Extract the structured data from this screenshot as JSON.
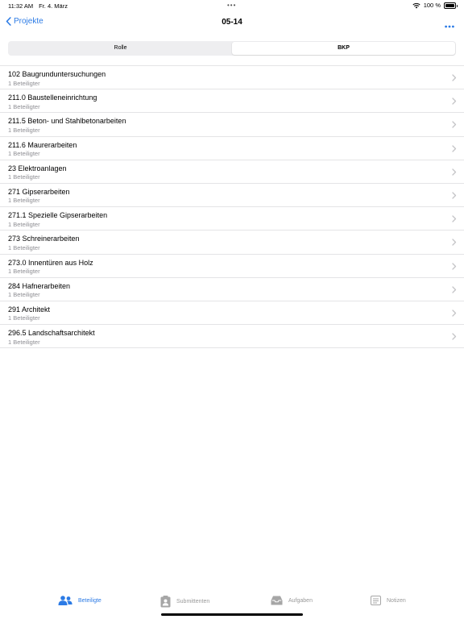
{
  "status_bar": {
    "time": "11:32 AM",
    "date": "Fr. 4. März",
    "dots": "•••",
    "battery": "100 %"
  },
  "nav": {
    "back_label": "Projekte",
    "title": "05-14"
  },
  "segments": [
    {
      "label": "Rolle",
      "selected": false
    },
    {
      "label": "BKP",
      "selected": true
    }
  ],
  "list": [
    {
      "title": "102 Baugrunduntersuchungen",
      "subtitle": "1 Beteiligter"
    },
    {
      "title": "211.0 Baustelleneinrichtung",
      "subtitle": "1 Beteiligter"
    },
    {
      "title": "211.5 Beton- und Stahlbetonarbeiten",
      "subtitle": "1 Beteiligter"
    },
    {
      "title": "211.6 Maurerarbeiten",
      "subtitle": "1 Beteiligter"
    },
    {
      "title": "23 Elektroanlagen",
      "subtitle": "1 Beteiligter"
    },
    {
      "title": "271 Gipserarbeiten",
      "subtitle": "1 Beteiligter"
    },
    {
      "title": "271.1 Spezielle Gipserarbeiten",
      "subtitle": "1 Beteiligter"
    },
    {
      "title": "273 Schreinerarbeiten",
      "subtitle": "1 Beteiligter"
    },
    {
      "title": "273.0 Innentüren aus Holz",
      "subtitle": "1 Beteiligter"
    },
    {
      "title": "284 Hafnerarbeiten",
      "subtitle": "1 Beteiligter"
    },
    {
      "title": "291 Architekt",
      "subtitle": "1 Beteiligter"
    },
    {
      "title": "296.5 Landschaftsarchitekt",
      "subtitle": "1 Beteiligter"
    }
  ],
  "tabs": [
    {
      "label": "Beteiligte",
      "icon": "people-icon",
      "active": true
    },
    {
      "label": "Submittenten",
      "icon": "contact-card-icon",
      "active": false
    },
    {
      "label": "Aufgaben",
      "icon": "tray-icon",
      "active": false
    },
    {
      "label": "Notizen",
      "icon": "notes-icon",
      "active": false
    }
  ],
  "colors": {
    "accent": "#2c7be5",
    "inactive": "#999999",
    "separator": "#e4e4e6",
    "subtitle": "#8e8e93"
  }
}
